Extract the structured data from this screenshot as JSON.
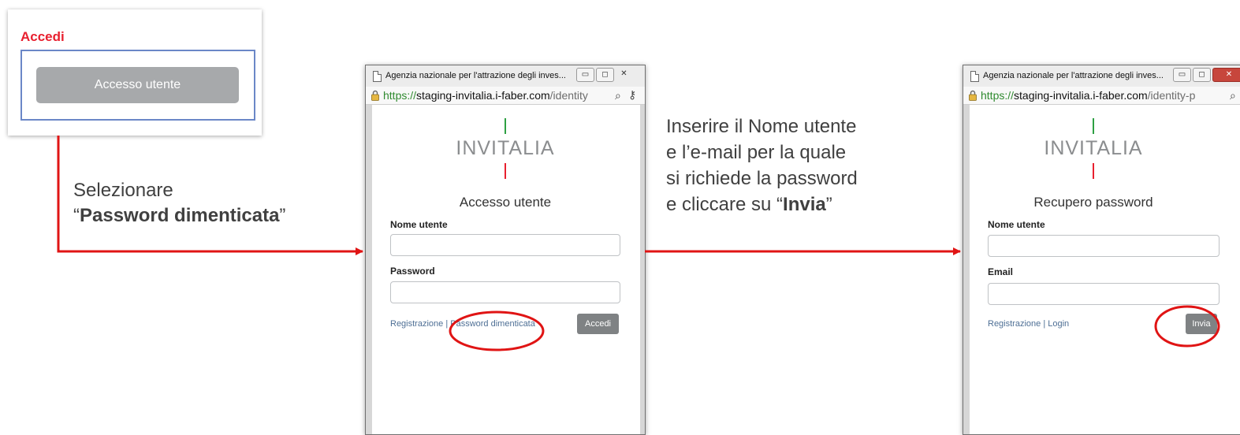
{
  "login_panel": {
    "title": "Accedi",
    "access_button": "Accesso utente"
  },
  "instructions": {
    "left": {
      "line1": "Selezionare",
      "quote_open": "“",
      "bold": "Password dimenticata",
      "quote_close": "”"
    },
    "right": {
      "line1": "Inserire il Nome utente",
      "line2": "e l’e-mail per la quale",
      "line3": "si richiede la password",
      "line4_prefix": "e cliccare su “",
      "line4_bold": "Invia",
      "line4_suffix": "”"
    }
  },
  "window1": {
    "title": "Agenzia nazionale per l'attrazione degli inves...",
    "url_scheme": "https://",
    "url_host": "staging-invitalia.i-faber.com",
    "url_path": "/identity",
    "logo": "INVITALIA",
    "form_title": "Accesso utente",
    "label_username": "Nome utente",
    "label_password": "Password",
    "link_register": "Registrazione",
    "link_separator": " | ",
    "link_forgot": "Password dimenticata",
    "submit": "Accedi"
  },
  "window2": {
    "title": "Agenzia nazionale per l'attrazione degli inves...",
    "url_scheme": "https://",
    "url_host": "staging-invitalia.i-faber.com",
    "url_path": "/identity-p",
    "logo": "INVITALIA",
    "form_title": "Recupero password",
    "label_username": "Nome utente",
    "label_email": "Email",
    "link_register": "Registrazione",
    "link_separator": " | ",
    "link_login": "Login",
    "submit": "Invia"
  },
  "colors": {
    "accent_red": "#e8202f",
    "arrow_red": "#e01414",
    "logo_green": "#2ea043",
    "button_gray": "#a7a9ab"
  }
}
